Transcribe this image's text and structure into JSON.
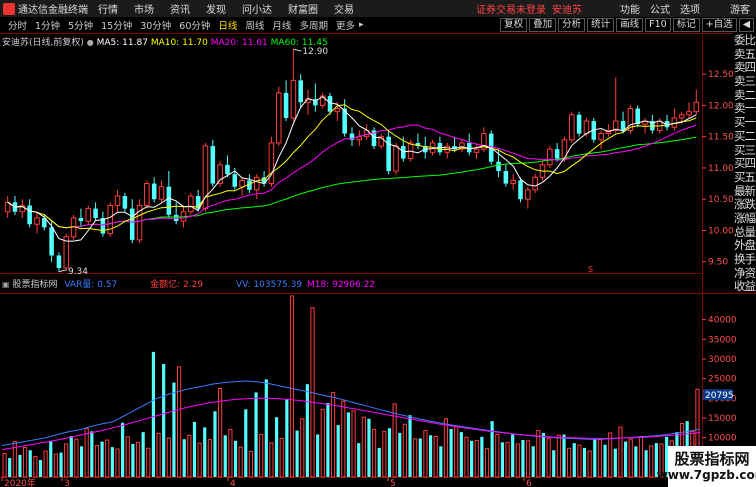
{
  "titlebar": {
    "app_name": "通达信金融终端",
    "menus": [
      "行情",
      "市场",
      "资讯",
      "发现",
      "问小达",
      "财富圈",
      "交易"
    ],
    "warning": "证券交易未登录",
    "stock": "安迪苏",
    "right_menus": [
      "功能",
      "公式",
      "选项"
    ],
    "guest": "游客"
  },
  "toolbar": {
    "periods": [
      "分时",
      "1分钟",
      "5分钟",
      "15分钟",
      "30分钟",
      "60分钟",
      "日线",
      "周线",
      "月线",
      "多周期",
      "更多"
    ],
    "active_period": "日线",
    "more_arrow": "▸",
    "buttons": [
      "复权",
      "叠加",
      "分析",
      "统计",
      "画线",
      "F10",
      "标记",
      "+自选"
    ],
    "back_icon": "◀"
  },
  "main_legend": {
    "title": "安迪苏(日线,前复权)",
    "ma5": "MA5: 11.87",
    "ma10": "MA10: 11.70",
    "ma20": "MA20: 11.61",
    "ma60": "MA60: 11.45",
    "ma5_color": "#ffffff",
    "ma10_color": "#ffff00",
    "ma20_color": "#ff00ff",
    "ma60_color": "#00ff00"
  },
  "sub_legend": {
    "title": "股票指标网",
    "series1": "VAR量: 0.57",
    "series2": "金额亿: 2.29",
    "series3": "VV: 103575.39",
    "series4": "M18: 92906.22"
  },
  "sidebar": {
    "items": [
      "委比",
      "卖五",
      "卖四",
      "卖三",
      "卖二",
      "卖一",
      "买一",
      "买二",
      "买三",
      "买四",
      "买五",
      "最新",
      "涨跌",
      "涨幅",
      "总量",
      "外盘",
      "换手",
      "净资",
      "收益"
    ]
  },
  "chart_data": [
    {
      "type": "candlestick",
      "title": "安迪苏(日线,前复权)",
      "y_ticks": [
        12.5,
        12.0,
        11.5,
        11.0,
        10.5,
        10.0,
        9.5
      ],
      "ylim": [
        9.4,
        12.95
      ],
      "annotations": [
        {
          "label": "12.90",
          "value": 12.9
        },
        {
          "label": "9.34",
          "value": 9.34
        }
      ],
      "x_labels": [
        "2020年",
        "3",
        "4",
        "5",
        "6"
      ],
      "candles": [
        {
          "o": 10.3,
          "h": 10.55,
          "l": 10.2,
          "c": 10.45
        },
        {
          "o": 10.45,
          "h": 10.55,
          "l": 10.25,
          "c": 10.3
        },
        {
          "o": 10.3,
          "h": 10.5,
          "l": 10.2,
          "c": 10.4
        },
        {
          "o": 10.4,
          "h": 10.5,
          "l": 10.05,
          "c": 10.1
        },
        {
          "o": 10.1,
          "h": 10.3,
          "l": 9.95,
          "c": 10.2
        },
        {
          "o": 10.2,
          "h": 10.25,
          "l": 10.0,
          "c": 10.05
        },
        {
          "o": 10.05,
          "h": 10.15,
          "l": 9.5,
          "c": 9.6
        },
        {
          "o": 9.6,
          "h": 9.65,
          "l": 9.34,
          "c": 9.4
        },
        {
          "o": 9.4,
          "h": 9.95,
          "l": 9.38,
          "c": 9.9
        },
        {
          "o": 9.9,
          "h": 10.25,
          "l": 9.85,
          "c": 10.2
        },
        {
          "o": 10.2,
          "h": 10.35,
          "l": 10.05,
          "c": 10.15
        },
        {
          "o": 10.15,
          "h": 10.4,
          "l": 10.1,
          "c": 10.35
        },
        {
          "o": 10.35,
          "h": 10.45,
          "l": 10.15,
          "c": 10.2
        },
        {
          "o": 10.2,
          "h": 10.3,
          "l": 9.9,
          "c": 9.95
        },
        {
          "o": 9.95,
          "h": 10.45,
          "l": 9.9,
          "c": 10.4
        },
        {
          "o": 10.4,
          "h": 10.65,
          "l": 10.3,
          "c": 10.55
        },
        {
          "o": 10.55,
          "h": 10.6,
          "l": 10.3,
          "c": 10.35
        },
        {
          "o": 10.35,
          "h": 10.5,
          "l": 9.8,
          "c": 9.85
        },
        {
          "o": 9.85,
          "h": 10.5,
          "l": 9.8,
          "c": 10.4
        },
        {
          "o": 10.4,
          "h": 10.8,
          "l": 10.35,
          "c": 10.75
        },
        {
          "o": 10.75,
          "h": 10.85,
          "l": 10.45,
          "c": 10.5
        },
        {
          "o": 10.5,
          "h": 10.8,
          "l": 10.45,
          "c": 10.7
        },
        {
          "o": 10.7,
          "h": 10.95,
          "l": 10.2,
          "c": 10.25
        },
        {
          "o": 10.25,
          "h": 10.45,
          "l": 10.1,
          "c": 10.15
        },
        {
          "o": 10.15,
          "h": 10.4,
          "l": 10.05,
          "c": 10.3
        },
        {
          "o": 10.3,
          "h": 10.6,
          "l": 10.25,
          "c": 10.55
        },
        {
          "o": 10.55,
          "h": 10.65,
          "l": 10.3,
          "c": 10.35
        },
        {
          "o": 10.35,
          "h": 11.4,
          "l": 10.3,
          "c": 11.35
        },
        {
          "o": 11.35,
          "h": 11.45,
          "l": 10.7,
          "c": 10.75
        },
        {
          "o": 10.75,
          "h": 11.1,
          "l": 10.7,
          "c": 11.05
        },
        {
          "o": 11.05,
          "h": 11.2,
          "l": 10.85,
          "c": 10.9
        },
        {
          "o": 10.9,
          "h": 11.0,
          "l": 10.65,
          "c": 10.7
        },
        {
          "o": 10.7,
          "h": 10.85,
          "l": 10.55,
          "c": 10.8
        },
        {
          "o": 10.8,
          "h": 10.9,
          "l": 10.6,
          "c": 10.65
        },
        {
          "o": 10.65,
          "h": 10.9,
          "l": 10.5,
          "c": 10.85
        },
        {
          "o": 10.85,
          "h": 10.95,
          "l": 10.7,
          "c": 10.75
        },
        {
          "o": 10.75,
          "h": 11.5,
          "l": 10.7,
          "c": 11.4
        },
        {
          "o": 11.4,
          "h": 12.3,
          "l": 11.35,
          "c": 12.2
        },
        {
          "o": 12.2,
          "h": 12.4,
          "l": 11.75,
          "c": 11.8
        },
        {
          "o": 11.8,
          "h": 12.9,
          "l": 11.75,
          "c": 12.4
        },
        {
          "o": 12.4,
          "h": 12.5,
          "l": 11.95,
          "c": 12.05
        },
        {
          "o": 12.05,
          "h": 12.25,
          "l": 11.85,
          "c": 12.1
        },
        {
          "o": 12.1,
          "h": 12.35,
          "l": 11.9,
          "c": 12.0
        },
        {
          "o": 12.0,
          "h": 12.2,
          "l": 11.95,
          "c": 12.15
        },
        {
          "o": 12.15,
          "h": 12.2,
          "l": 11.85,
          "c": 11.9
        },
        {
          "o": 11.9,
          "h": 12.05,
          "l": 11.75,
          "c": 11.95
        },
        {
          "o": 11.95,
          "h": 12.1,
          "l": 11.5,
          "c": 11.55
        },
        {
          "o": 11.55,
          "h": 11.65,
          "l": 11.35,
          "c": 11.45
        },
        {
          "o": 11.45,
          "h": 11.6,
          "l": 11.35,
          "c": 11.5
        },
        {
          "o": 11.5,
          "h": 11.7,
          "l": 11.45,
          "c": 11.6
        },
        {
          "o": 11.6,
          "h": 11.65,
          "l": 11.3,
          "c": 11.35
        },
        {
          "o": 11.35,
          "h": 11.55,
          "l": 11.3,
          "c": 11.5
        },
        {
          "o": 11.5,
          "h": 11.6,
          "l": 10.9,
          "c": 10.95
        },
        {
          "o": 10.95,
          "h": 11.4,
          "l": 10.9,
          "c": 11.35
        },
        {
          "o": 11.35,
          "h": 11.5,
          "l": 11.1,
          "c": 11.15
        },
        {
          "o": 11.15,
          "h": 11.45,
          "l": 11.1,
          "c": 11.4
        },
        {
          "o": 11.4,
          "h": 11.55,
          "l": 11.3,
          "c": 11.35
        },
        {
          "o": 11.35,
          "h": 11.5,
          "l": 11.15,
          "c": 11.25
        },
        {
          "o": 11.25,
          "h": 11.45,
          "l": 11.2,
          "c": 11.4
        },
        {
          "o": 11.4,
          "h": 11.5,
          "l": 11.2,
          "c": 11.25
        },
        {
          "o": 11.25,
          "h": 11.4,
          "l": 11.15,
          "c": 11.35
        },
        {
          "o": 11.35,
          "h": 11.5,
          "l": 11.25,
          "c": 11.3
        },
        {
          "o": 11.3,
          "h": 11.45,
          "l": 11.25,
          "c": 11.4
        },
        {
          "o": 11.4,
          "h": 11.55,
          "l": 11.2,
          "c": 11.25
        },
        {
          "o": 11.25,
          "h": 11.4,
          "l": 11.15,
          "c": 11.3
        },
        {
          "o": 11.3,
          "h": 11.65,
          "l": 11.25,
          "c": 11.55
        },
        {
          "o": 11.55,
          "h": 11.6,
          "l": 11.05,
          "c": 11.1
        },
        {
          "o": 11.1,
          "h": 11.3,
          "l": 10.85,
          "c": 10.95
        },
        {
          "o": 10.95,
          "h": 11.05,
          "l": 10.7,
          "c": 10.75
        },
        {
          "o": 10.75,
          "h": 10.9,
          "l": 10.65,
          "c": 10.8
        },
        {
          "o": 10.8,
          "h": 10.85,
          "l": 10.45,
          "c": 10.5
        },
        {
          "o": 10.5,
          "h": 10.7,
          "l": 10.35,
          "c": 10.65
        },
        {
          "o": 10.65,
          "h": 10.9,
          "l": 10.6,
          "c": 10.85
        },
        {
          "o": 10.85,
          "h": 11.1,
          "l": 10.8,
          "c": 11.05
        },
        {
          "o": 11.05,
          "h": 11.35,
          "l": 11.0,
          "c": 11.3
        },
        {
          "o": 11.3,
          "h": 11.4,
          "l": 11.1,
          "c": 11.15
        },
        {
          "o": 11.15,
          "h": 11.5,
          "l": 11.1,
          "c": 11.45
        },
        {
          "o": 11.45,
          "h": 11.9,
          "l": 11.4,
          "c": 11.85
        },
        {
          "o": 11.85,
          "h": 11.9,
          "l": 11.5,
          "c": 11.55
        },
        {
          "o": 11.55,
          "h": 11.8,
          "l": 11.5,
          "c": 11.75
        },
        {
          "o": 11.75,
          "h": 11.8,
          "l": 11.4,
          "c": 11.45
        },
        {
          "o": 11.45,
          "h": 11.6,
          "l": 11.3,
          "c": 11.55
        },
        {
          "o": 11.55,
          "h": 11.7,
          "l": 11.5,
          "c": 11.6
        },
        {
          "o": 11.6,
          "h": 12.45,
          "l": 11.55,
          "c": 11.75
        },
        {
          "o": 11.75,
          "h": 11.9,
          "l": 11.55,
          "c": 11.6
        },
        {
          "o": 11.6,
          "h": 12.0,
          "l": 11.55,
          "c": 11.95
        },
        {
          "o": 11.95,
          "h": 12.0,
          "l": 11.65,
          "c": 11.7
        },
        {
          "o": 11.7,
          "h": 11.8,
          "l": 11.55,
          "c": 11.75
        },
        {
          "o": 11.75,
          "h": 11.85,
          "l": 11.55,
          "c": 11.6
        },
        {
          "o": 11.6,
          "h": 11.8,
          "l": 11.55,
          "c": 11.75
        },
        {
          "o": 11.75,
          "h": 11.85,
          "l": 11.6,
          "c": 11.65
        },
        {
          "o": 11.65,
          "h": 11.95,
          "l": 11.6,
          "c": 11.8
        },
        {
          "o": 11.8,
          "h": 11.9,
          "l": 11.7,
          "c": 11.85
        },
        {
          "o": 11.85,
          "h": 12.05,
          "l": 11.8,
          "c": 11.9
        },
        {
          "o": 11.9,
          "h": 12.25,
          "l": 11.85,
          "c": 12.05
        }
      ]
    },
    {
      "type": "bar",
      "title": "股票指标网",
      "y_ticks": [
        40000,
        35000,
        30000,
        25000,
        20000,
        15000,
        10000,
        5000
      ],
      "ylim": [
        0,
        46000
      ],
      "current_value_label": "20795",
      "bars_red": [
        6000,
        9000,
        7500,
        5200,
        6600,
        5800,
        8400,
        9600,
        12300,
        8000,
        9400,
        7100,
        10200,
        8800,
        7300,
        11100,
        9900,
        28000,
        10600,
        8600,
        9500,
        22500,
        12100,
        7600,
        6500,
        10800,
        8700,
        9800,
        46000,
        14800,
        43000,
        17200,
        21500,
        19300,
        16800,
        15200,
        12100,
        11600,
        18600,
        13400,
        9700,
        11800,
        10300,
        14800,
        12800,
        10100,
        9300,
        7200,
        10800,
        8800,
        8400,
        9200,
        11800,
        9800,
        10600,
        7300,
        8100,
        6600,
        9500,
        11200,
        12700,
        9600,
        10300,
        7900,
        8400,
        9200,
        13600,
        11600,
        22300
      ],
      "bars_cyan": [
        4800,
        5600,
        6800,
        4300,
        9200,
        6200,
        10400,
        7800,
        11600,
        9000,
        7600,
        13800,
        8400,
        11400,
        31800,
        28700,
        24000,
        9600,
        14000,
        12600,
        16700,
        10600,
        9200,
        17200,
        21500,
        24800,
        15200,
        19800,
        11800,
        23600,
        10800,
        18800,
        13200,
        16400,
        8600,
        14800,
        7400,
        12400,
        11200,
        15700,
        9800,
        10600,
        7800,
        12200,
        11400,
        9200,
        10200,
        14200,
        8800,
        10800,
        9400,
        7800,
        11200,
        6800,
        10800,
        8600,
        7400,
        9600,
        8200,
        7200,
        9000,
        7800,
        6800,
        8600,
        10200,
        11400,
        14200
      ],
      "series": [
        {
          "name": "VV",
          "values": [
            8000,
            8500,
            9000,
            9500,
            10000,
            10800,
            11500,
            12000,
            12800,
            13500,
            14000,
            15500,
            17000,
            18500,
            20000,
            21000,
            21800,
            22500,
            23000,
            23600,
            24000,
            24200,
            24400,
            24200,
            23800,
            23200,
            22600,
            22000,
            21400,
            20800,
            20200,
            19500,
            18700,
            18000,
            17200,
            16500,
            15800,
            15200,
            14600,
            14000,
            13500,
            13000,
            12600,
            12200,
            11800,
            11400,
            11000,
            10700,
            10400,
            10200,
            10000,
            9800,
            9700,
            9600,
            9600,
            9700,
            9900,
            10100,
            10300,
            10500,
            10800,
            11200,
            11600,
            12200
          ]
        },
        {
          "name": "M18",
          "values": [
            7000,
            7400,
            7900,
            8400,
            8900,
            9400,
            10000,
            10600,
            11200,
            11800,
            12500,
            13200,
            14000,
            14800,
            15600,
            16400,
            17200,
            17900,
            18500,
            19000,
            19400,
            19700,
            19900,
            20000,
            20000,
            19900,
            19700,
            19400,
            19000,
            18600,
            18200,
            17700,
            17200,
            16700,
            16200,
            15700,
            15200,
            14700,
            14200,
            13700,
            13200,
            12800,
            12400,
            12000,
            11600,
            11300,
            11000,
            10700,
            10500,
            10300,
            10100,
            10000,
            9900,
            9800,
            9800,
            9800,
            9900,
            10000,
            10100,
            10300,
            10500,
            10700,
            11000,
            11300
          ]
        }
      ]
    }
  ]
}
